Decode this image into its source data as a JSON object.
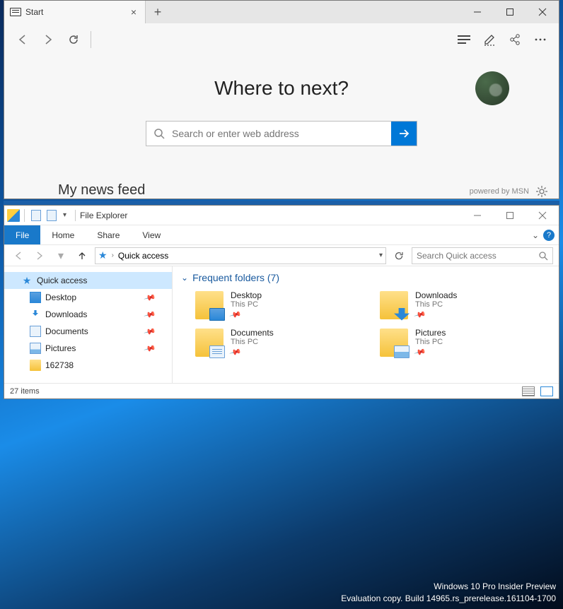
{
  "edge": {
    "tab_title": "Start",
    "heading": "Where to next?",
    "search_placeholder": "Search or enter web address",
    "news_heading": "My news feed",
    "powered_by": "powered by MSN"
  },
  "explorer": {
    "title": "File Explorer",
    "ribbon": {
      "file": "File",
      "home": "Home",
      "share": "Share",
      "view": "View"
    },
    "address_location": "Quick access",
    "search_placeholder": "Search Quick access",
    "nav": {
      "root": "Quick access",
      "items": [
        {
          "label": "Desktop",
          "icon": "desktop",
          "pinned": true
        },
        {
          "label": "Downloads",
          "icon": "downloads",
          "pinned": true
        },
        {
          "label": "Documents",
          "icon": "documents",
          "pinned": true
        },
        {
          "label": "Pictures",
          "icon": "pictures",
          "pinned": true
        },
        {
          "label": "162738",
          "icon": "folder",
          "pinned": false
        }
      ]
    },
    "frequent_header": "Frequent folders (7)",
    "folders": [
      {
        "name": "Desktop",
        "location": "This PC",
        "icon": "desktop"
      },
      {
        "name": "Downloads",
        "location": "This PC",
        "icon": "downloads"
      },
      {
        "name": "Documents",
        "location": "This PC",
        "icon": "documents"
      },
      {
        "name": "Pictures",
        "location": "This PC",
        "icon": "pictures"
      }
    ],
    "status_items": "27 items"
  },
  "watermark": {
    "line1": "Windows 10 Pro Insider Preview",
    "line2": "Evaluation copy. Build 14965.rs_prerelease.161104-1700"
  }
}
